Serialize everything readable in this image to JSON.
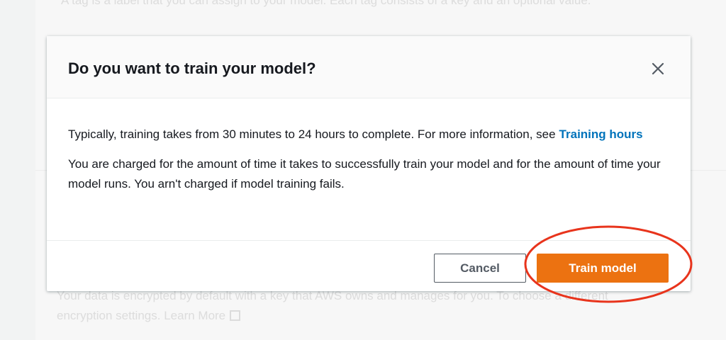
{
  "background": {
    "top_text": "A tag is a label that you can assign to your model. Each tag consists of a key and an optional value.",
    "encryption_text": "Your data is encrypted by default with a key that AWS owns and manages for you. To choose a different",
    "encryption_text_line2": "encryption settings.",
    "learn_more_link": "Learn More",
    "external_link_icon": "external-link-icon"
  },
  "modal": {
    "title": "Do you want to train your model?",
    "close_icon": "close-icon",
    "paragraph1_text": "Typically, training takes from 30 minutes to 24 hours to complete. For more information, see",
    "paragraph1_link": "Training hours",
    "paragraph2_text": "You are charged for the amount of time it takes to successfully train your model and for the amount of time your model runs. You arn't charged if model training fails.",
    "cancel_label": "Cancel",
    "primary_label": "Train model"
  },
  "colors": {
    "primary_button": "#ec7211",
    "link": "#0073bb",
    "annotation_ellipse": "#e8341c"
  }
}
